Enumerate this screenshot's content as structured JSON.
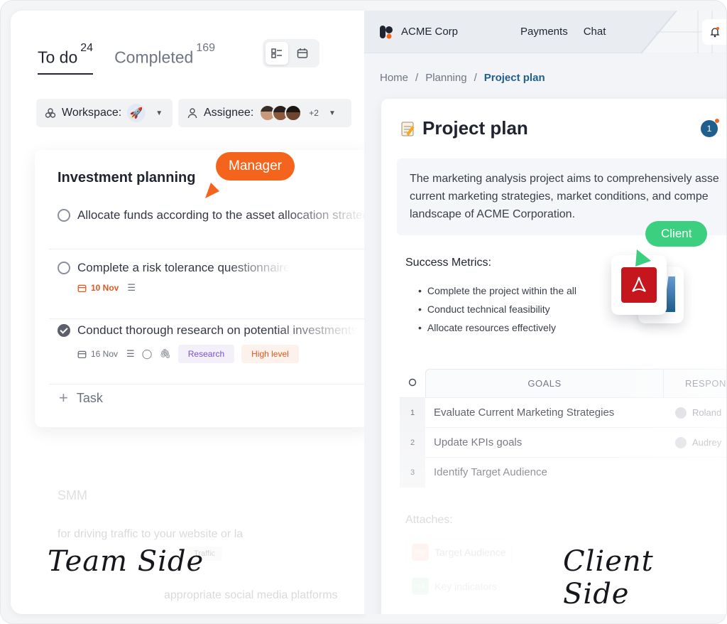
{
  "colors": {
    "accent_orange": "#f5641d",
    "accent_green": "#3bcf7f",
    "link_blue": "#1f5f8e",
    "pdf_red": "#c4161c"
  },
  "team": {
    "tabs": [
      {
        "label": "To do",
        "count": "24"
      },
      {
        "label": "Completed",
        "count": "169"
      }
    ],
    "view_toggle": {
      "icons": [
        "list-view-icon",
        "calendar-icon"
      ]
    },
    "filters": {
      "workspace_label": "Workspace:",
      "assignee_label": "Assignee:",
      "assignee_more": "+2"
    },
    "card": {
      "title": "Investment planning",
      "tasks": [
        {
          "text": "Allocate funds according to the asset allocation strategy",
          "done": false
        },
        {
          "text": "Complete a risk tolerance questionnaire",
          "done": false,
          "date": "10 Nov"
        },
        {
          "text": "Conduct thorough research on potential investments",
          "done": true,
          "date": "16 Nov",
          "tags": [
            "Research",
            "High level"
          ]
        }
      ],
      "add_label": "Task"
    },
    "faded": {
      "heading": "SMM",
      "task1": "for driving traffic to your website or la",
      "tag": "Traffic",
      "task2": "appropriate social media platforms"
    },
    "script_label": "Team Side"
  },
  "callouts": {
    "manager": "Manager",
    "client": "Client"
  },
  "client": {
    "brand": "ACME Corp",
    "nav": [
      "Payments",
      "Chat"
    ],
    "breadcrumb": [
      "Home",
      "Planning",
      "Project plan"
    ],
    "doc": {
      "title": "Project plan",
      "notification_count": "1",
      "summary_lines": [
        "The marketing analysis project aims to comprehensively asse",
        "current marketing strategies, market conditions, and compe",
        "landscape of ACME Corporation."
      ],
      "metrics_heading": "Success Metrics:",
      "metrics": [
        "Complete the project within the all",
        "Conduct technical feasibility",
        "Allocate resources effectively"
      ],
      "table": {
        "headers": {
          "goals": "GOALS",
          "responsible": "RESPON"
        },
        "rows": [
          {
            "n": "1",
            "goal": "Evaluate Current Marketing Strategies",
            "resp": "Roland"
          },
          {
            "n": "2",
            "goal": "Update KPIs goals",
            "resp": "Audrey"
          },
          {
            "n": "3",
            "goal": "Identify Target Audience",
            "resp": ""
          }
        ]
      },
      "attaches_heading": "Attaches:",
      "attaches": [
        {
          "type": "PDF",
          "name": "Target Audience"
        },
        {
          "type": "XLS",
          "name": "Key indicators"
        }
      ]
    },
    "script_label": "Client Side"
  }
}
